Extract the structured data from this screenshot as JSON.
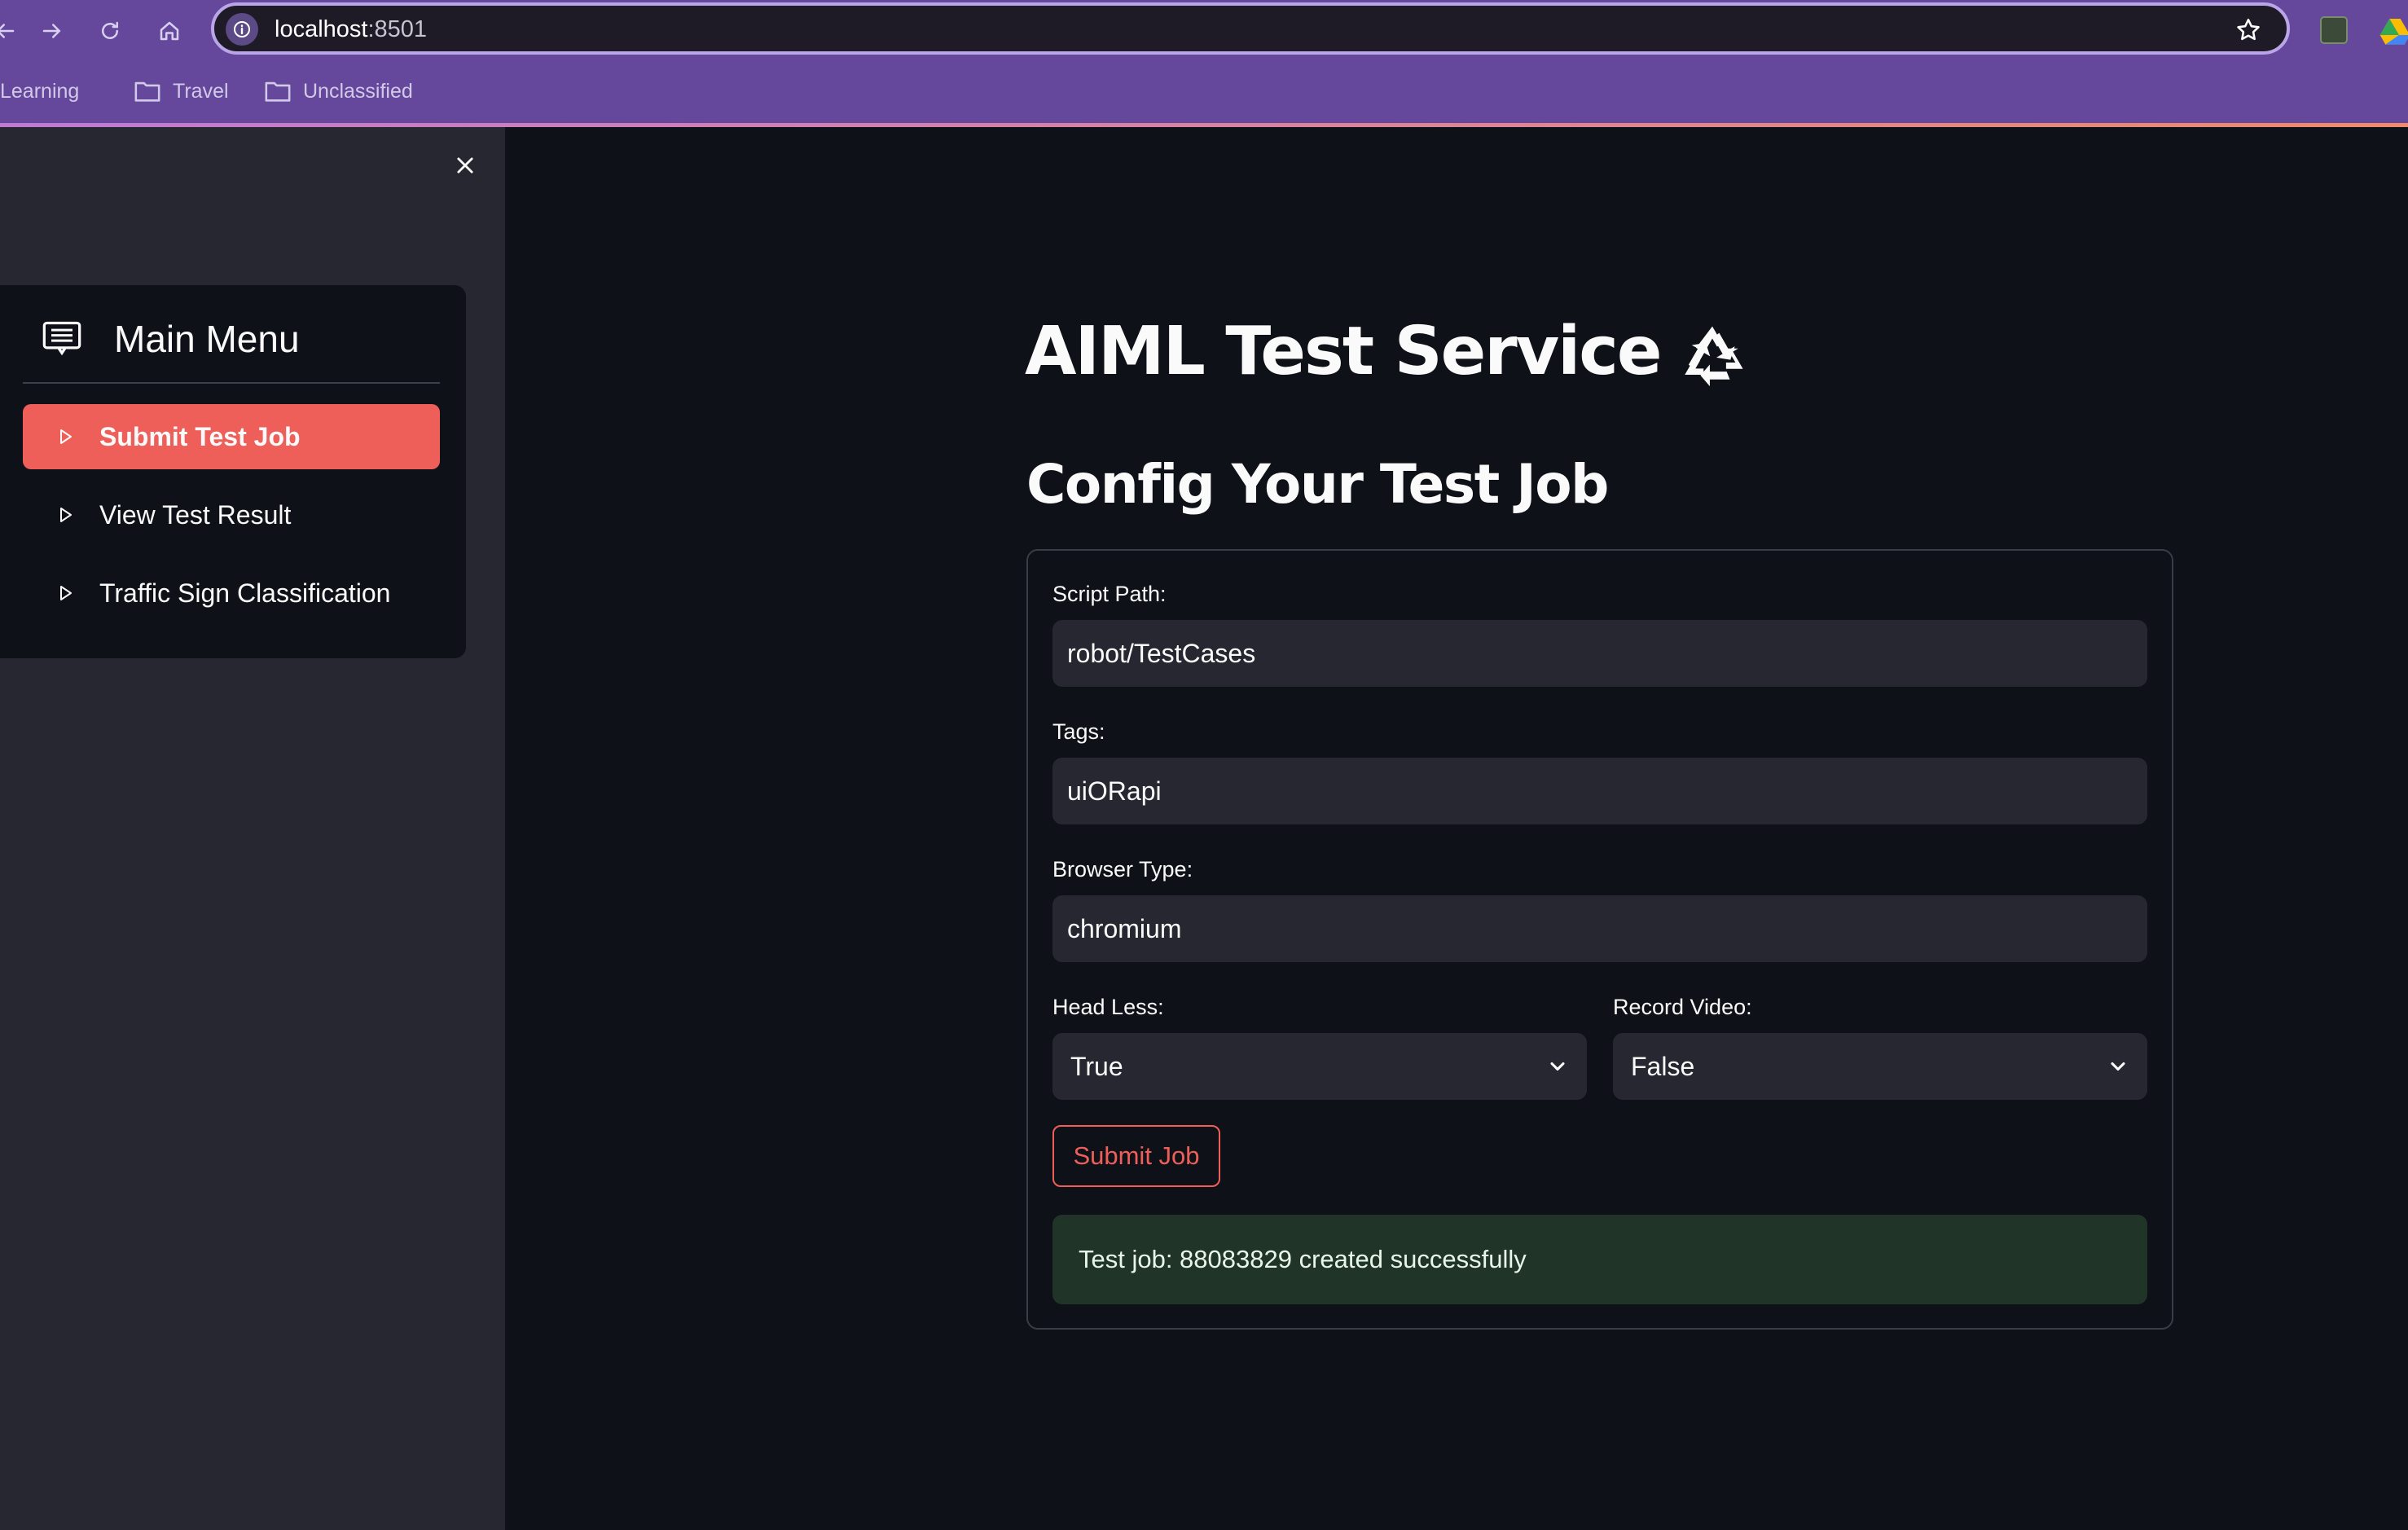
{
  "browser": {
    "url_host": "localhost",
    "url_port": ":8501",
    "bookmarks": [
      "Learning",
      "Travel",
      "Unclassified"
    ]
  },
  "sidebar": {
    "menu_title": "Main Menu",
    "items": [
      {
        "label": "Submit Test Job",
        "active": true
      },
      {
        "label": "View Test Result",
        "active": false
      },
      {
        "label": "Traffic Sign Classification",
        "active": false
      }
    ]
  },
  "main": {
    "title": "AIML Test Service",
    "subtitle": "Config Your Test Job",
    "form": {
      "script_path_label": "Script Path:",
      "script_path_value": "robot/TestCases",
      "tags_label": "Tags:",
      "tags_value": "uiORapi",
      "browser_type_label": "Browser Type:",
      "browser_type_value": "chromium",
      "head_less_label": "Head Less:",
      "head_less_value": "True",
      "record_video_label": "Record Video:",
      "record_video_value": "False",
      "submit_label": "Submit Job"
    },
    "success_message": "Test job: 88083829 created successfully"
  },
  "colors": {
    "chrome_bg": "#65489c",
    "app_bg": "#0e1117",
    "sidebar_bg": "#262730",
    "accent": "#ef5f59",
    "success_bg": "#203528"
  }
}
